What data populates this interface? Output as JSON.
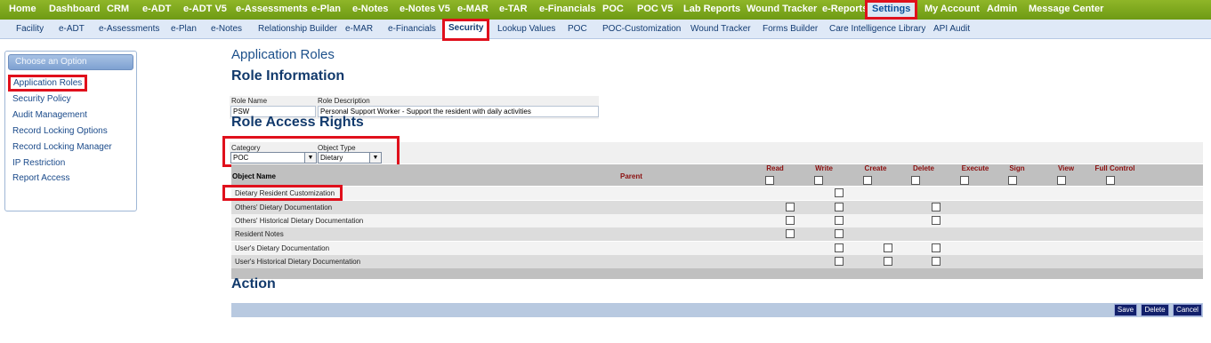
{
  "top_nav": [
    {
      "label": "Home",
      "active": false
    },
    {
      "label": "Dashboard",
      "active": false
    },
    {
      "label": "CRM",
      "active": false
    },
    {
      "label": "e-ADT",
      "active": false
    },
    {
      "label": "e-ADT V5",
      "active": false
    },
    {
      "label": "e-Assessments",
      "active": false
    },
    {
      "label": "e-Plan",
      "active": false
    },
    {
      "label": "e-Notes",
      "active": false
    },
    {
      "label": "e-Notes V5",
      "active": false
    },
    {
      "label": "e-MAR",
      "active": false
    },
    {
      "label": "e-TAR",
      "active": false
    },
    {
      "label": "e-Financials",
      "active": false
    },
    {
      "label": "POC",
      "active": false
    },
    {
      "label": "POC V5",
      "active": false
    },
    {
      "label": "Lab Reports",
      "active": false
    },
    {
      "label": "Wound Tracker",
      "active": false
    },
    {
      "label": "e-Reports",
      "active": false
    },
    {
      "label": "Settings",
      "active": true
    },
    {
      "label": "My Account",
      "active": false
    },
    {
      "label": "Admin",
      "active": false
    },
    {
      "label": "Message Center",
      "active": false
    }
  ],
  "sub_nav": [
    {
      "label": "Facility",
      "active": false
    },
    {
      "label": "e-ADT",
      "active": false
    },
    {
      "label": "e-Assessments",
      "active": false
    },
    {
      "label": "e-Plan",
      "active": false
    },
    {
      "label": "e-Notes",
      "active": false
    },
    {
      "label": "Relationship Builder",
      "active": false
    },
    {
      "label": "e-MAR",
      "active": false
    },
    {
      "label": "e-Financials",
      "active": false
    },
    {
      "label": "Security",
      "active": true
    },
    {
      "label": "Lookup Values",
      "active": false
    },
    {
      "label": "POC",
      "active": false
    },
    {
      "label": "POC-Customization",
      "active": false
    },
    {
      "label": "Wound Tracker",
      "active": false
    },
    {
      "label": "Forms Builder",
      "active": false
    },
    {
      "label": "Care Intelligence Library",
      "active": false
    },
    {
      "label": "API Audit",
      "active": false
    }
  ],
  "sidebar": {
    "header": "Choose an Option",
    "items": [
      {
        "label": "Application Roles",
        "active": true
      },
      {
        "label": "Security Policy",
        "active": false
      },
      {
        "label": "Audit Management",
        "active": false
      },
      {
        "label": "Record Locking Options",
        "active": false
      },
      {
        "label": "Record Locking Manager",
        "active": false
      },
      {
        "label": "IP Restriction",
        "active": false
      },
      {
        "label": "Report Access",
        "active": false
      }
    ]
  },
  "page": {
    "title": "Application Roles",
    "role_info_heading": "Role Information",
    "role_name_label": "Role Name",
    "role_name_value": "PSW",
    "role_desc_label": "Role Description",
    "role_desc_value": "Personal Support Worker - Support the resident with daily activities",
    "access_heading": "Role Access Rights",
    "category_label": "Category",
    "category_value": "POC",
    "object_type_label": "Object Type",
    "object_type_value": "Dietary",
    "action_heading": "Action"
  },
  "table": {
    "object_name_header": "Object Name",
    "parent_header": "Parent",
    "columns": [
      "Read",
      "Write",
      "Create",
      "Delete",
      "Execute",
      "Sign",
      "View",
      "Full Control"
    ],
    "rows": [
      {
        "name": "Dietary Resident Customization",
        "checks": [
          false,
          true,
          false,
          false,
          false,
          false,
          false,
          false
        ],
        "highlight": true
      },
      {
        "name": "Others' Dietary Documentation",
        "checks": [
          true,
          true,
          false,
          true,
          false,
          false,
          false,
          false
        ],
        "highlight": false
      },
      {
        "name": "Others' Historical Dietary Documentation",
        "checks": [
          true,
          true,
          false,
          true,
          false,
          false,
          false,
          false
        ],
        "highlight": false
      },
      {
        "name": "Resident Notes",
        "checks": [
          true,
          true,
          false,
          false,
          false,
          false,
          false,
          false
        ],
        "highlight": false
      },
      {
        "name": "User's Dietary Documentation",
        "checks": [
          false,
          true,
          true,
          true,
          false,
          false,
          false,
          false
        ],
        "highlight": false
      },
      {
        "name": "User's Historical Dietary Documentation",
        "checks": [
          false,
          true,
          true,
          true,
          false,
          false,
          false,
          false
        ],
        "highlight": false
      }
    ]
  },
  "buttons": {
    "save": "Save",
    "delete": "Delete",
    "cancel": "Cancel"
  },
  "colors": {
    "top_nav": "#7aa51b",
    "sub_nav": "#dfe9f7",
    "highlight": "#e0101c",
    "heading": "#1b4f8a",
    "header_band": "#bfbfbf",
    "action_bar": "#b8c9e0",
    "button": "#12206b"
  }
}
